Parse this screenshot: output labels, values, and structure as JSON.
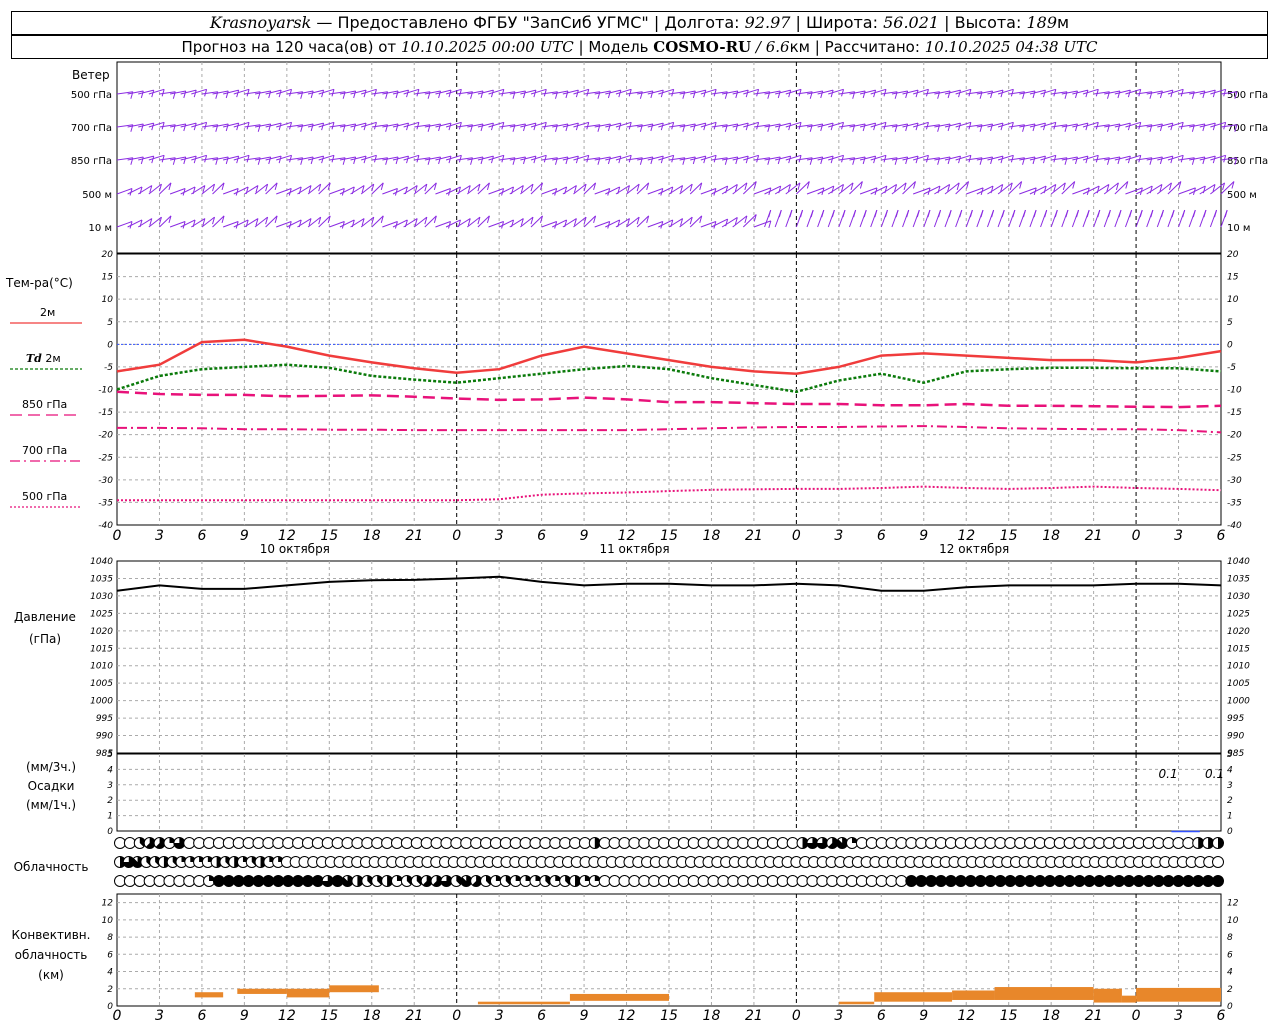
{
  "header": {
    "station": "Krasnoyarsk",
    "provider": "— Предоставлено ФГБУ \"ЗапСиб УГМС\"",
    "lon_label": "Долгота:",
    "lon_value": "92.97",
    "lat_label": "Широта:",
    "lat_value": "56.021",
    "alt_label": "Высота:",
    "alt_value": "189",
    "alt_unit": "м",
    "forecast_label": "Прогноз на 120 часа(ов) от",
    "forecast_start": "10.10.2025 00:00 UTC",
    "model_label": "Модель",
    "model_name": "COSMO-RU",
    "model_res": "/ 6.6",
    "model_res_unit": "км",
    "calc_label": "Рассчитано:",
    "calc_time": "10.10.2025 04:38 UTC"
  },
  "labels": {
    "wind": "Ветер",
    "temp": "Тем-ра(°C)",
    "t2m": "2м",
    "td": "Td",
    "td2m": "2м",
    "t850": "850 гПа",
    "t700": "700 гПа",
    "t500": "500 гПа",
    "pressure": "Давление",
    "pressure_unit": "(гПа)",
    "precip_unit3": "(мм/3ч.)",
    "precip": "Осадки",
    "precip_unit1": "(мм/1ч.)",
    "cloud": "Облачность",
    "conv1": "Конвективн.",
    "conv2": "облачность",
    "conv3": "(км)",
    "wind_levels": [
      "500 гПа",
      "700 гПа",
      "850 гПа",
      "500 м",
      "10 м"
    ],
    "hours": [
      "0",
      "3",
      "6",
      "9",
      "12",
      "15",
      "18",
      "21",
      "0",
      "3",
      "6",
      "9",
      "12",
      "15",
      "18",
      "21",
      "0",
      "3",
      "6",
      "9",
      "12",
      "15",
      "18",
      "21",
      "0",
      "3",
      "6"
    ],
    "days": [
      "10 октября",
      "11 октября",
      "12 октября"
    ],
    "precip_notes": [
      "0.1",
      "0.1"
    ]
  },
  "colors": {
    "wind": "#8a2be2",
    "t2m": "#f03c3c",
    "td": "#0a7a0a",
    "levels": "#e8127a",
    "zero": "#3050ff",
    "pressure": "#000000",
    "conv": "#e8872a",
    "precip": "#3050ff"
  },
  "chart_data": [
    {
      "type": "line",
      "panel": "temperature",
      "x_unit": "hours since 10.10.2025 00:00 UTC",
      "ylim": [
        -40,
        20
      ],
      "yticks": [
        20,
        15,
        10,
        5,
        0,
        -5,
        -10,
        -15,
        -20,
        -25,
        -30,
        -35,
        -40
      ],
      "x": [
        0,
        3,
        6,
        9,
        12,
        15,
        18,
        21,
        24,
        27,
        30,
        33,
        36,
        39,
        42,
        45,
        48,
        51,
        54,
        57,
        60,
        63,
        66,
        69,
        72,
        75,
        78
      ],
      "series": [
        {
          "name": "2м",
          "values": [
            -6,
            -4.5,
            0.5,
            1,
            -0.5,
            -2.5,
            -4,
            -5.3,
            -6.3,
            -5.5,
            -2.5,
            -0.5,
            -2,
            -3.5,
            -5,
            -6,
            -6.5,
            -5,
            -2.5,
            -2,
            -2.5,
            -3,
            -3.5,
            -3.5,
            -4,
            -3,
            -1.5
          ]
        },
        {
          "name": "Td 2м",
          "values": [
            -10,
            -7,
            -5.5,
            -5,
            -4.5,
            -5.2,
            -7,
            -7.8,
            -8.5,
            -7.5,
            -6.5,
            -5.5,
            -4.8,
            -5.5,
            -7.5,
            -9,
            -10.5,
            -8,
            -6.5,
            -8.5,
            -6,
            -5.5,
            -5.2,
            -5.2,
            -5.3,
            -5.3,
            -6
          ]
        },
        {
          "name": "850 гПа",
          "values": [
            -10.5,
            -11,
            -11.2,
            -11.2,
            -11.5,
            -11.4,
            -11.3,
            -11.6,
            -12,
            -12.3,
            -12.2,
            -11.8,
            -12.2,
            -12.8,
            -12.8,
            -13,
            -13.2,
            -13.2,
            -13.5,
            -13.5,
            -13.2,
            -13.6,
            -13.6,
            -13.7,
            -13.8,
            -13.9,
            -13.6
          ]
        },
        {
          "name": "700 гПа",
          "values": [
            -18.5,
            -18.5,
            -18.6,
            -18.8,
            -18.8,
            -18.9,
            -18.9,
            -19,
            -19,
            -19,
            -19,
            -19,
            -19,
            -18.8,
            -18.6,
            -18.4,
            -18.3,
            -18.3,
            -18.2,
            -18.1,
            -18.3,
            -18.6,
            -18.7,
            -18.8,
            -18.8,
            -19,
            -19.5
          ]
        },
        {
          "name": "500 гПа",
          "values": [
            -34.5,
            -34.5,
            -34.5,
            -34.5,
            -34.5,
            -34.5,
            -34.5,
            -34.5,
            -34.5,
            -34.3,
            -33.3,
            -33,
            -32.8,
            -32.5,
            -32.2,
            -32.1,
            -32,
            -32,
            -31.8,
            -31.5,
            -31.8,
            -32,
            -31.8,
            -31.5,
            -31.8,
            -32,
            -32.3
          ]
        }
      ]
    },
    {
      "type": "line",
      "panel": "pressure",
      "x_unit": "hours since 10.10.2025 00:00 UTC",
      "ylim": [
        985,
        1040
      ],
      "yticks": [
        1040,
        1035,
        1030,
        1025,
        1020,
        1015,
        1010,
        1005,
        1000,
        995,
        990,
        985
      ],
      "x": [
        0,
        3,
        6,
        9,
        12,
        15,
        18,
        21,
        24,
        27,
        30,
        33,
        36,
        39,
        42,
        45,
        48,
        51,
        54,
        57,
        60,
        63,
        66,
        69,
        72,
        75,
        78
      ],
      "series": [
        {
          "name": "Давление",
          "values": [
            1031.5,
            1033,
            1032,
            1032,
            1033,
            1034,
            1034.5,
            1034.6,
            1035,
            1035.5,
            1034,
            1033,
            1033.5,
            1033.5,
            1033,
            1033,
            1033.5,
            1033,
            1031.5,
            1031.5,
            1032.5,
            1033,
            1033,
            1033,
            1033.5,
            1033.5,
            1033
          ]
        }
      ]
    },
    {
      "type": "bar",
      "panel": "precipitation",
      "ylim": [
        0,
        5
      ],
      "yticks": [
        5,
        4,
        3,
        2,
        1,
        0
      ],
      "x": [
        75,
        78
      ],
      "values_3h": [
        0.1,
        0.1
      ]
    },
    {
      "type": "area",
      "panel": "convective_cloud",
      "x_unit": "hours since 10.10.2025 00:00 UTC",
      "ylim": [
        0,
        13
      ],
      "yticks": [
        12,
        10,
        8,
        6,
        4,
        2,
        0
      ],
      "segments": [
        {
          "x0": 5.5,
          "x1": 7.5,
          "bottom": 1,
          "top": 1.6
        },
        {
          "x0": 8.5,
          "x1": 12,
          "bottom": 1.4,
          "top": 2
        },
        {
          "x0": 12,
          "x1": 15,
          "bottom": 1,
          "top": 2
        },
        {
          "x0": 15,
          "x1": 18.5,
          "bottom": 1.6,
          "top": 2.4
        },
        {
          "x0": 25.5,
          "x1": 32,
          "bottom": 0.2,
          "top": 0.5
        },
        {
          "x0": 32,
          "x1": 39,
          "bottom": 0.6,
          "top": 1.4
        },
        {
          "x0": 51,
          "x1": 53.5,
          "bottom": 0.2,
          "top": 0.5
        },
        {
          "x0": 53.5,
          "x1": 59,
          "bottom": 0.5,
          "top": 1.6
        },
        {
          "x0": 59,
          "x1": 62,
          "bottom": 0.7,
          "top": 1.8
        },
        {
          "x0": 62,
          "x1": 69,
          "bottom": 0.7,
          "top": 2.2
        },
        {
          "x0": 69,
          "x1": 71,
          "bottom": 0.4,
          "top": 2
        },
        {
          "x0": 71,
          "x1": 72,
          "bottom": 0.4,
          "top": 1.2
        },
        {
          "x0": 72,
          "x1": 78,
          "bottom": 0.5,
          "top": 2.1
        }
      ]
    },
    {
      "type": "table",
      "panel": "cloud_cover_octas",
      "legend": "0=clear, 1-3=partly, 4=half, 5-7=mostly, 8=overcast",
      "rows": [
        [
          0,
          0,
          3,
          5,
          5,
          2,
          6,
          0,
          0,
          0,
          0,
          0,
          0,
          0,
          0,
          0,
          0,
          0,
          0,
          0,
          0,
          0,
          0,
          0,
          0,
          0,
          0,
          0,
          0,
          0,
          0,
          0,
          0,
          0,
          0,
          0,
          0,
          0,
          0,
          0,
          0,
          0,
          0,
          0,
          0,
          0,
          0,
          0,
          4,
          0,
          0,
          0,
          0,
          0,
          0,
          0,
          0,
          0,
          0,
          0,
          0,
          0,
          0,
          0,
          0,
          0,
          0,
          0,
          0,
          4,
          6,
          6,
          5,
          7,
          2,
          0,
          0,
          0,
          0,
          0,
          0,
          0,
          0,
          0,
          0,
          0,
          0,
          0,
          0,
          0,
          0,
          0,
          0,
          0,
          0,
          0,
          0,
          0,
          0,
          0,
          0,
          0,
          0,
          0,
          0,
          0,
          0,
          0,
          0,
          4,
          4,
          4
        ],
        [
          4,
          6,
          7,
          3,
          3,
          4,
          3,
          2,
          2,
          2,
          2,
          4,
          3,
          4,
          2,
          3,
          4,
          2,
          2,
          0,
          0,
          0,
          0,
          0,
          0,
          0,
          0,
          0,
          0,
          0,
          0,
          0,
          0,
          0,
          0,
          0,
          0,
          0,
          0,
          0,
          0,
          0,
          0,
          0,
          0,
          0,
          0,
          0,
          0,
          0,
          0,
          0,
          0,
          0,
          0,
          0,
          0,
          0,
          0,
          0,
          0,
          0,
          0,
          0,
          0,
          0,
          0,
          0,
          0,
          0,
          0,
          0,
          0,
          0,
          0,
          0,
          0,
          0,
          0,
          0,
          0,
          0,
          0,
          0,
          0,
          0,
          0,
          0,
          0,
          0,
          0,
          0,
          0,
          0,
          0,
          0,
          0,
          0,
          0,
          0,
          0,
          0,
          0,
          0,
          0,
          0,
          0,
          0,
          0,
          0,
          0,
          0,
          0,
          0,
          0,
          0,
          0,
          0,
          0,
          0,
          0,
          0,
          0,
          0,
          0,
          0
        ],
        [
          0,
          0,
          0,
          0,
          0,
          0,
          0,
          0,
          0,
          2,
          8,
          8,
          8,
          8,
          8,
          8,
          8,
          8,
          8,
          8,
          8,
          6,
          8,
          7,
          4,
          3,
          3,
          4,
          2,
          3,
          3,
          5,
          5,
          6,
          3,
          7,
          5,
          3,
          2,
          3,
          2,
          2,
          2,
          3,
          2,
          3,
          4,
          2,
          2,
          0,
          0,
          0,
          0,
          0,
          0,
          0,
          0,
          0,
          0,
          0,
          0,
          0,
          0,
          0,
          0,
          0,
          0,
          0,
          0,
          0,
          0,
          0,
          0,
          0,
          0,
          0,
          0,
          0,
          0,
          0,
          8,
          8,
          8,
          8,
          8,
          8,
          8,
          8,
          8,
          8,
          8,
          8,
          8,
          8,
          8,
          8,
          8,
          8,
          8,
          8,
          8,
          8,
          8,
          8,
          8,
          8,
          8,
          8,
          8,
          8,
          8,
          8
        ]
      ]
    }
  ]
}
